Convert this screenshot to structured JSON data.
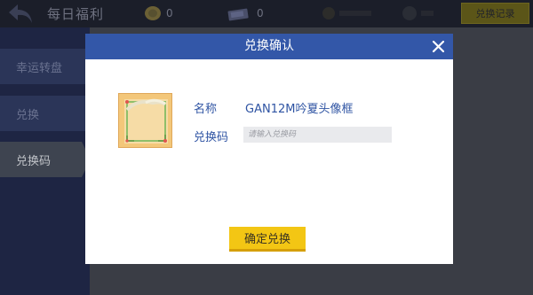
{
  "topbar": {
    "title": "每日福利",
    "coin_count": "0",
    "ticket_count": "0",
    "history_label": "兑换记录"
  },
  "sidebar": {
    "items": [
      {
        "label": "幸运转盘"
      },
      {
        "label": "兑换"
      },
      {
        "label": "兑换码",
        "active": true
      }
    ]
  },
  "dialog": {
    "title": "兑换确认",
    "name_label": "名称",
    "name_value": "GAN12M吟夏头像框",
    "code_label": "兑换码",
    "code_placeholder": "请输入兑换码",
    "code_value": "",
    "confirm_label": "确定兑换"
  },
  "colors": {
    "header_blue": "#3357a8",
    "text_blue": "#2f54a3",
    "confirm_yellow": "#f3c614",
    "frame_gold": "#f3c77a"
  }
}
